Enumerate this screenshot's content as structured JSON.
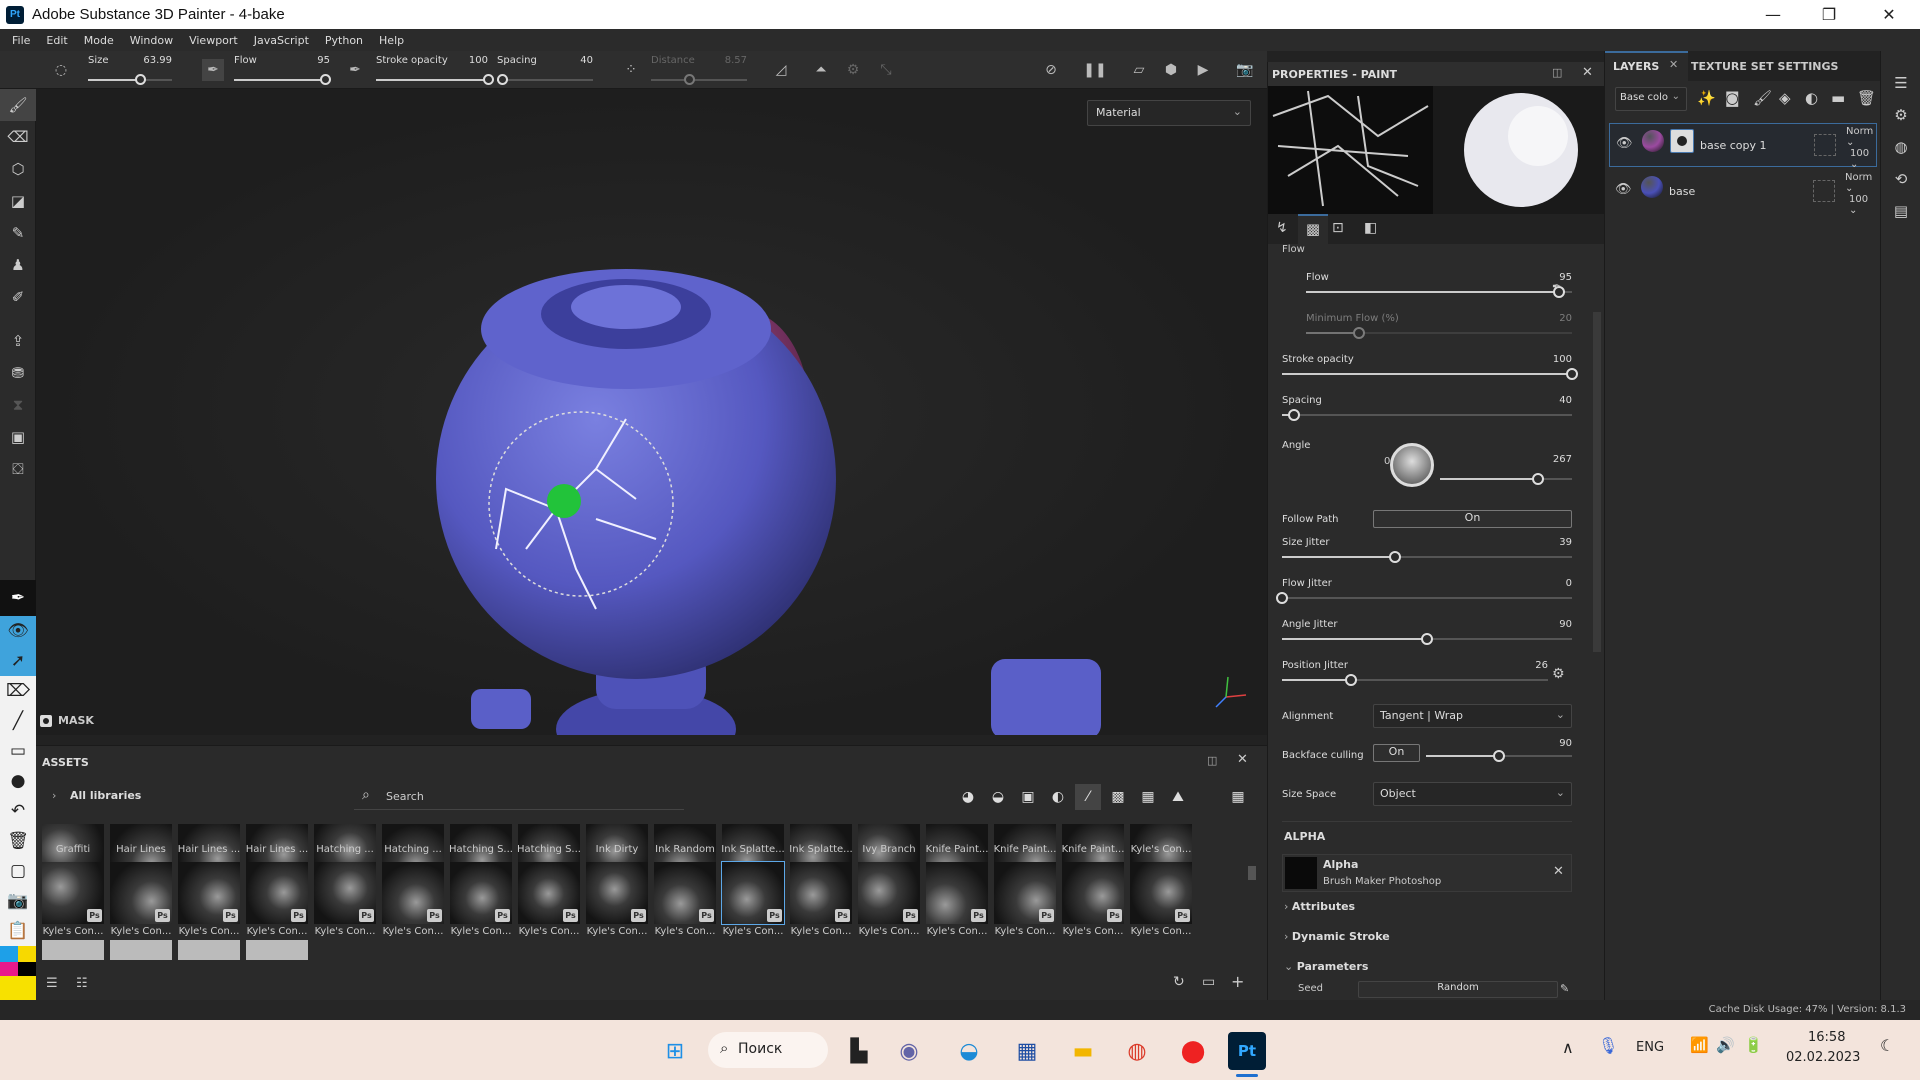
{
  "window": {
    "app_icon": "Pt",
    "title": "Adobe Substance 3D Painter - 4-bake",
    "controls": {
      "minimize": "—",
      "restore": "❐",
      "close": "✕"
    }
  },
  "menu": [
    "File",
    "Edit",
    "Mode",
    "Window",
    "Viewport",
    "JavaScript",
    "Python",
    "Help"
  ],
  "toolbar": {
    "size": {
      "label": "Size",
      "value": "63.99",
      "fraction": 0.62
    },
    "flow": {
      "label": "Flow",
      "value": "95",
      "fraction": 0.95
    },
    "stroke_opacity": {
      "label": "Stroke opacity",
      "value": "100",
      "fraction": 1.0
    },
    "spacing": {
      "label": "Spacing",
      "value": "40",
      "fraction": 0.05
    },
    "distance": {
      "label": "Distance",
      "value": "8.57",
      "fraction": 0.4
    }
  },
  "viewport": {
    "display_mode": "Material",
    "mask_label": "MASK"
  },
  "assets": {
    "title": "ASSETS",
    "library": "All libraries",
    "search_placeholder": "Search",
    "row1_labels": [
      "Graffiti",
      "Hair Lines",
      "Hair Lines ...",
      "Hair Lines ...",
      "Hatching ...",
      "Hatching ...",
      "Hatching S...",
      "Hatching S...",
      "Ink Dirty",
      "Ink Random",
      "Ink Splatte...",
      "Ink Splatte...",
      "Ivy Branch",
      "Knife Paint...",
      "Knife Paint...",
      "Knife Paint...",
      "Kyle's Con..."
    ],
    "row2_labels": [
      "Kyle's Con...",
      "Kyle's Con...",
      "Kyle's Con...",
      "Kyle's Con...",
      "Kyle's Con...",
      "Kyle's Con...",
      "Kyle's Con...",
      "Kyle's Con...",
      "Kyle's Con...",
      "Kyle's Con...",
      "Kyle's Con...",
      "Kyle's Con...",
      "Kyle's Con...",
      "Kyle's Con...",
      "Kyle's Con...",
      "Kyle's Con...",
      "Kyle's Con..."
    ],
    "badge": "Ps",
    "selected_index": 10
  },
  "properties": {
    "title": "PROPERTIES - PAINT",
    "section_cut": "Flow",
    "flow": {
      "label": "Flow",
      "value": "95",
      "fraction": 0.95
    },
    "min_flow": {
      "label": "Minimum Flow (%)",
      "value": "20",
      "fraction": 0.2
    },
    "stroke_opacity": {
      "label": "Stroke opacity",
      "value": "100",
      "fraction": 1.0
    },
    "spacing": {
      "label": "Spacing",
      "value": "40",
      "fraction": 0.04
    },
    "angle": {
      "label": "Angle",
      "value": "267",
      "dial_zero": "0",
      "fraction": 0.74
    },
    "follow_path": {
      "label": "Follow Path",
      "value": "On"
    },
    "size_jitter": {
      "label": "Size Jitter",
      "value": "39",
      "fraction": 0.39
    },
    "flow_jitter": {
      "label": "Flow Jitter",
      "value": "0",
      "fraction": 0.0
    },
    "angle_jitter": {
      "label": "Angle Jitter",
      "value": "90",
      "fraction": 0.5
    },
    "position_jitter": {
      "label": "Position Jitter",
      "value": "26",
      "fraction": 0.26
    },
    "alignment": {
      "label": "Alignment",
      "value": "Tangent | Wrap"
    },
    "backface_culling": {
      "label": "Backface culling",
      "toggle": "On",
      "value": "90",
      "fraction": 0.5
    },
    "size_space": {
      "label": "Size Space",
      "value": "Object"
    },
    "alpha_header": "ALPHA",
    "alpha": {
      "name": "Alpha",
      "source": "Brush Maker Photoshop"
    },
    "sections": [
      "Attributes",
      "Dynamic Stroke",
      "Parameters"
    ],
    "seed": {
      "label": "Seed",
      "value": "Random"
    }
  },
  "layers": {
    "tab_layers": "LAYERS",
    "tab_texture": "TEXTURE SET SETTINGS",
    "channel": "Base colo",
    "items": [
      {
        "name": "base copy 1",
        "blend": "Norm",
        "opacity": "100",
        "color": "#9b4aa0",
        "selected": true
      },
      {
        "name": "base",
        "blend": "Norm",
        "opacity": "100",
        "color": "#4a50b8",
        "selected": false
      }
    ]
  },
  "status": {
    "text": "Cache Disk Usage:   47% | Version: 8.1.3"
  },
  "taskbar": {
    "search": "Поиск",
    "lang": "ENG",
    "time": "16:58",
    "date": "02.02.2023"
  },
  "colors": {
    "accent": "#3fa3dc",
    "selection_border": "#3b6b9c",
    "paint_blue": "#5a5fc8",
    "paint_purple": "#9a3f7a"
  }
}
